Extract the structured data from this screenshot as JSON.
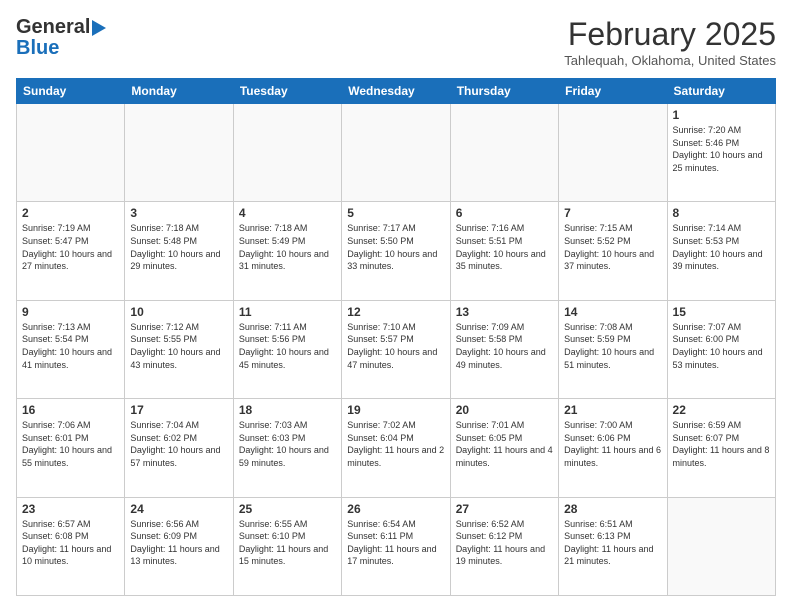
{
  "header": {
    "logo_line1": "General",
    "logo_line2": "Blue",
    "month": "February 2025",
    "location": "Tahlequah, Oklahoma, United States"
  },
  "weekdays": [
    "Sunday",
    "Monday",
    "Tuesday",
    "Wednesday",
    "Thursday",
    "Friday",
    "Saturday"
  ],
  "weeks": [
    [
      {
        "day": "",
        "info": ""
      },
      {
        "day": "",
        "info": ""
      },
      {
        "day": "",
        "info": ""
      },
      {
        "day": "",
        "info": ""
      },
      {
        "day": "",
        "info": ""
      },
      {
        "day": "",
        "info": ""
      },
      {
        "day": "1",
        "info": "Sunrise: 7:20 AM\nSunset: 5:46 PM\nDaylight: 10 hours and 25 minutes."
      }
    ],
    [
      {
        "day": "2",
        "info": "Sunrise: 7:19 AM\nSunset: 5:47 PM\nDaylight: 10 hours and 27 minutes."
      },
      {
        "day": "3",
        "info": "Sunrise: 7:18 AM\nSunset: 5:48 PM\nDaylight: 10 hours and 29 minutes."
      },
      {
        "day": "4",
        "info": "Sunrise: 7:18 AM\nSunset: 5:49 PM\nDaylight: 10 hours and 31 minutes."
      },
      {
        "day": "5",
        "info": "Sunrise: 7:17 AM\nSunset: 5:50 PM\nDaylight: 10 hours and 33 minutes."
      },
      {
        "day": "6",
        "info": "Sunrise: 7:16 AM\nSunset: 5:51 PM\nDaylight: 10 hours and 35 minutes."
      },
      {
        "day": "7",
        "info": "Sunrise: 7:15 AM\nSunset: 5:52 PM\nDaylight: 10 hours and 37 minutes."
      },
      {
        "day": "8",
        "info": "Sunrise: 7:14 AM\nSunset: 5:53 PM\nDaylight: 10 hours and 39 minutes."
      }
    ],
    [
      {
        "day": "9",
        "info": "Sunrise: 7:13 AM\nSunset: 5:54 PM\nDaylight: 10 hours and 41 minutes."
      },
      {
        "day": "10",
        "info": "Sunrise: 7:12 AM\nSunset: 5:55 PM\nDaylight: 10 hours and 43 minutes."
      },
      {
        "day": "11",
        "info": "Sunrise: 7:11 AM\nSunset: 5:56 PM\nDaylight: 10 hours and 45 minutes."
      },
      {
        "day": "12",
        "info": "Sunrise: 7:10 AM\nSunset: 5:57 PM\nDaylight: 10 hours and 47 minutes."
      },
      {
        "day": "13",
        "info": "Sunrise: 7:09 AM\nSunset: 5:58 PM\nDaylight: 10 hours and 49 minutes."
      },
      {
        "day": "14",
        "info": "Sunrise: 7:08 AM\nSunset: 5:59 PM\nDaylight: 10 hours and 51 minutes."
      },
      {
        "day": "15",
        "info": "Sunrise: 7:07 AM\nSunset: 6:00 PM\nDaylight: 10 hours and 53 minutes."
      }
    ],
    [
      {
        "day": "16",
        "info": "Sunrise: 7:06 AM\nSunset: 6:01 PM\nDaylight: 10 hours and 55 minutes."
      },
      {
        "day": "17",
        "info": "Sunrise: 7:04 AM\nSunset: 6:02 PM\nDaylight: 10 hours and 57 minutes."
      },
      {
        "day": "18",
        "info": "Sunrise: 7:03 AM\nSunset: 6:03 PM\nDaylight: 10 hours and 59 minutes."
      },
      {
        "day": "19",
        "info": "Sunrise: 7:02 AM\nSunset: 6:04 PM\nDaylight: 11 hours and 2 minutes."
      },
      {
        "day": "20",
        "info": "Sunrise: 7:01 AM\nSunset: 6:05 PM\nDaylight: 11 hours and 4 minutes."
      },
      {
        "day": "21",
        "info": "Sunrise: 7:00 AM\nSunset: 6:06 PM\nDaylight: 11 hours and 6 minutes."
      },
      {
        "day": "22",
        "info": "Sunrise: 6:59 AM\nSunset: 6:07 PM\nDaylight: 11 hours and 8 minutes."
      }
    ],
    [
      {
        "day": "23",
        "info": "Sunrise: 6:57 AM\nSunset: 6:08 PM\nDaylight: 11 hours and 10 minutes."
      },
      {
        "day": "24",
        "info": "Sunrise: 6:56 AM\nSunset: 6:09 PM\nDaylight: 11 hours and 13 minutes."
      },
      {
        "day": "25",
        "info": "Sunrise: 6:55 AM\nSunset: 6:10 PM\nDaylight: 11 hours and 15 minutes."
      },
      {
        "day": "26",
        "info": "Sunrise: 6:54 AM\nSunset: 6:11 PM\nDaylight: 11 hours and 17 minutes."
      },
      {
        "day": "27",
        "info": "Sunrise: 6:52 AM\nSunset: 6:12 PM\nDaylight: 11 hours and 19 minutes."
      },
      {
        "day": "28",
        "info": "Sunrise: 6:51 AM\nSunset: 6:13 PM\nDaylight: 11 hours and 21 minutes."
      },
      {
        "day": "",
        "info": ""
      }
    ]
  ]
}
